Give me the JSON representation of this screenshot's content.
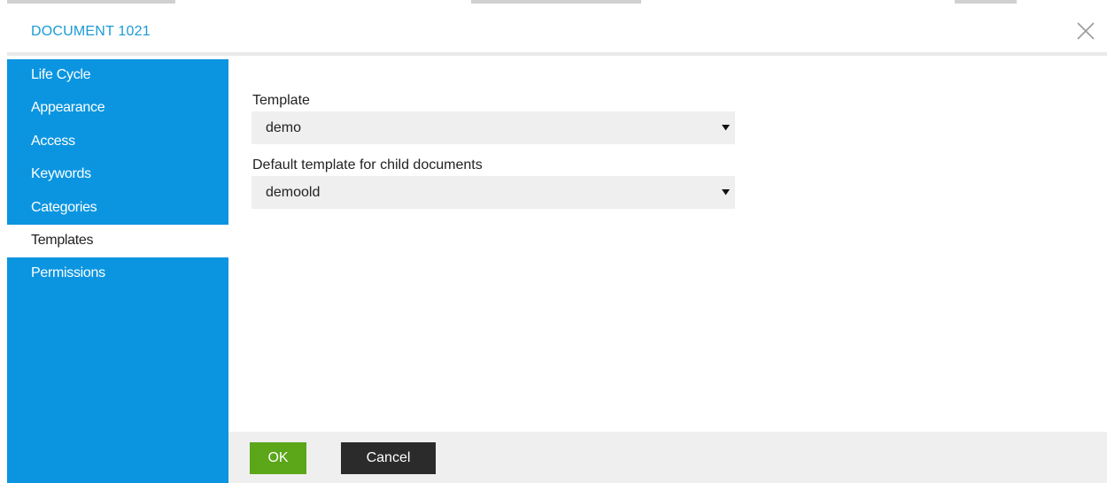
{
  "dialog": {
    "title": "DOCUMENT 1021",
    "close_icon": "close-icon"
  },
  "sidebar": {
    "items": [
      {
        "label": "Life Cycle",
        "active": false
      },
      {
        "label": "Appearance",
        "active": false
      },
      {
        "label": "Access",
        "active": false
      },
      {
        "label": "Keywords",
        "active": false
      },
      {
        "label": "Categories",
        "active": false
      },
      {
        "label": "Templates",
        "active": true
      },
      {
        "label": "Permissions",
        "active": false
      }
    ]
  },
  "form": {
    "template": {
      "label": "Template",
      "value": "demo"
    },
    "child_template": {
      "label": "Default template for child documents",
      "value": "demoold"
    }
  },
  "footer": {
    "ok_label": "OK",
    "cancel_label": "Cancel"
  },
  "colors": {
    "accent": "#0b95e0",
    "title": "#1a9ad6",
    "ok": "#5ba619",
    "cancel": "#2b2b2b"
  }
}
